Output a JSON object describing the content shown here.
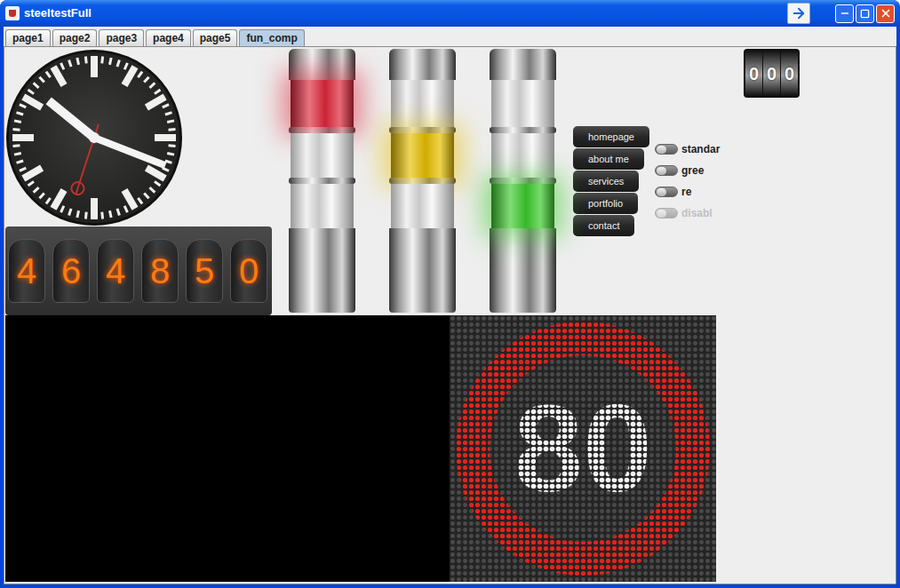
{
  "window": {
    "title": "steeltestFull"
  },
  "tabs": [
    {
      "label": "page1",
      "selected": false
    },
    {
      "label": "page2",
      "selected": false
    },
    {
      "label": "page3",
      "selected": false
    },
    {
      "label": "page4",
      "selected": false
    },
    {
      "label": "page5",
      "selected": false
    },
    {
      "label": "fun_comp",
      "selected": true
    }
  ],
  "clock": {
    "hours": 10,
    "minutes": 18,
    "seconds": 33
  },
  "nixie": {
    "digits": [
      "4",
      "6",
      "4",
      "8",
      "5",
      "0"
    ]
  },
  "towers": [
    {
      "color": "#e0283c",
      "lit": 0
    },
    {
      "color": "#e8c000",
      "lit": 1
    },
    {
      "color": "#3ccc2c",
      "lit": 2
    }
  ],
  "menu": [
    {
      "label": "homepage"
    },
    {
      "label": "about me"
    },
    {
      "label": "services"
    },
    {
      "label": "portfolio"
    },
    {
      "label": "contact"
    }
  ],
  "toggles": [
    {
      "label": "standar",
      "on": false,
      "disabled": false
    },
    {
      "label": "gree",
      "on": false,
      "disabled": false
    },
    {
      "label": "re",
      "on": false,
      "disabled": false
    },
    {
      "label": "disabl",
      "on": false,
      "disabled": true
    }
  ],
  "odometer": {
    "digits": [
      "0",
      "0",
      "0"
    ]
  },
  "sign": {
    "text": "80"
  }
}
